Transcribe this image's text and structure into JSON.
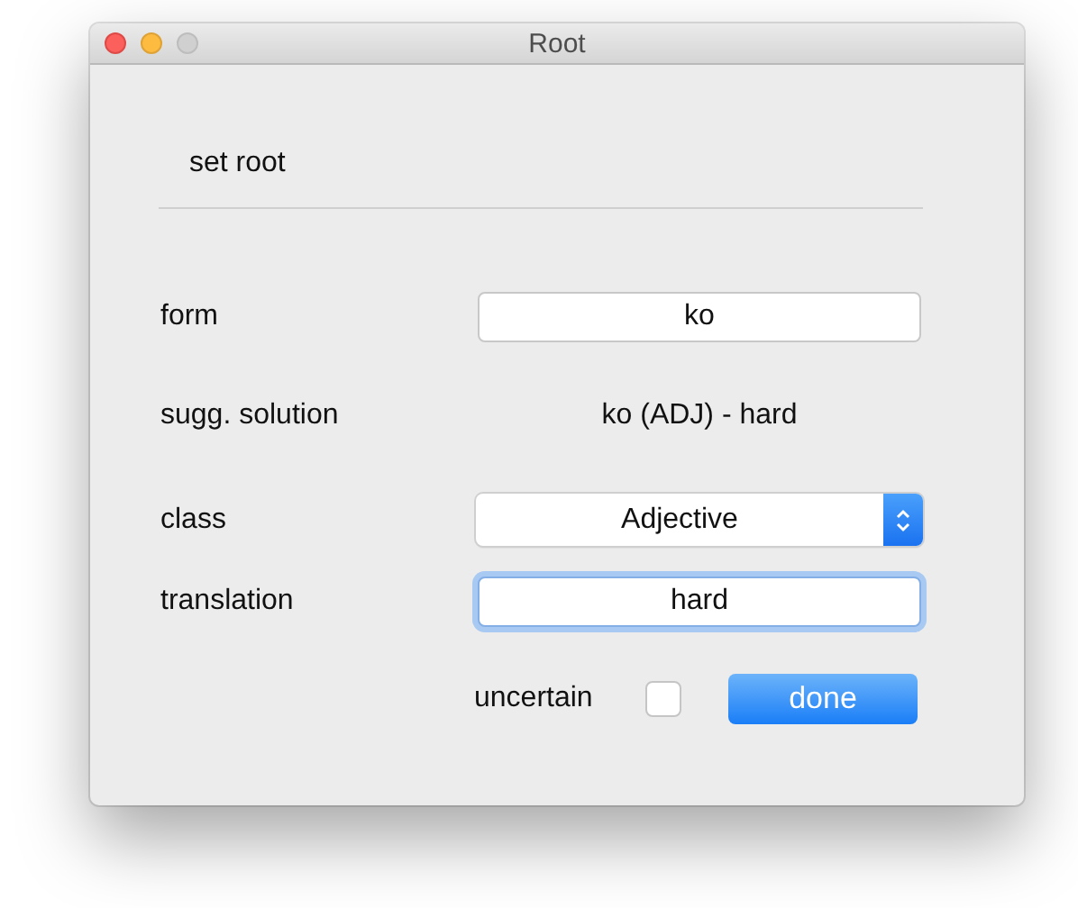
{
  "window": {
    "title": "Root"
  },
  "heading": "set root",
  "rows": [
    {
      "kind": "field",
      "label": "form",
      "value": "ko",
      "focused": false
    },
    {
      "kind": "text",
      "label": "sugg. solution",
      "value": "ko (ADJ) - hard"
    },
    {
      "kind": "popup",
      "label": "class",
      "value": "Adjective"
    },
    {
      "kind": "field",
      "label": "translation",
      "value": "hard",
      "focused": true
    }
  ],
  "uncertain": {
    "label": "uncertain",
    "checked": false
  },
  "buttons": [
    {
      "label": "done"
    }
  ]
}
